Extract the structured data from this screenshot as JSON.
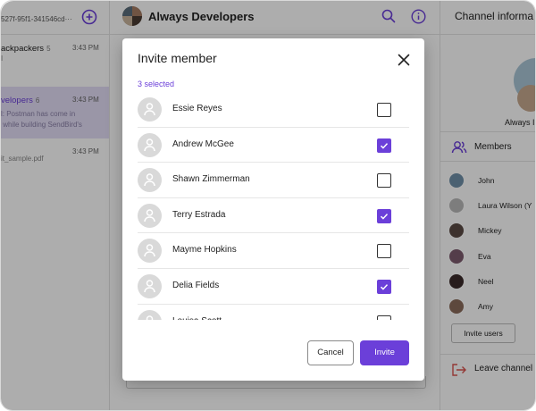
{
  "colors": {
    "accent": "#6b3fd9",
    "overlay": "rgba(0,0,0,0.32)"
  },
  "sidebar": {
    "user_id": "527f-95f1-341546cd···",
    "new_chat_icon": "new-chat-icon",
    "channels": [
      {
        "name": "ackpackers",
        "count": "5",
        "time": "3:43 PM",
        "preview": "",
        "active": false
      },
      {
        "name": "velopers",
        "count": "6",
        "time": "3:43 PM",
        "preview": "l: Postman has come in\n while building SendBird's",
        "active": true
      },
      {
        "name": "",
        "count": "",
        "time": "3:43 PM",
        "preview": "it_sample.pdf",
        "active": false
      }
    ]
  },
  "conversation": {
    "title": "Always Developers",
    "search_icon": "search-icon",
    "info_icon": "info-icon"
  },
  "channel_info": {
    "title": "Channel informa",
    "channel_name": "Always I",
    "members_label": "Members",
    "members": [
      {
        "name": "John",
        "avatar_color": "#6f8fa8"
      },
      {
        "name": "Laura Wilson (Y",
        "avatar_color": "#b9b9b9"
      },
      {
        "name": "Mickey",
        "avatar_color": "#5a4a44"
      },
      {
        "name": "Eva",
        "avatar_color": "#7c5a6e"
      },
      {
        "name": "Neel",
        "avatar_color": "#3a2a2a"
      },
      {
        "name": "Amy",
        "avatar_color": "#8a6a5a"
      }
    ],
    "invite_users_label": "Invite users",
    "leave_label": "Leave channel"
  },
  "modal": {
    "title": "Invite member",
    "selected_text": "3 selected",
    "users": [
      {
        "name": "Essie Reyes",
        "checked": false
      },
      {
        "name": "Andrew McGee",
        "checked": true
      },
      {
        "name": "Shawn Zimmerman",
        "checked": false
      },
      {
        "name": "Terry Estrada",
        "checked": true
      },
      {
        "name": "Mayme Hopkins",
        "checked": false
      },
      {
        "name": "Delia Fields",
        "checked": true
      },
      {
        "name": "Louisa Scott",
        "checked": false
      }
    ],
    "cancel_label": "Cancel",
    "invite_label": "Invite"
  }
}
